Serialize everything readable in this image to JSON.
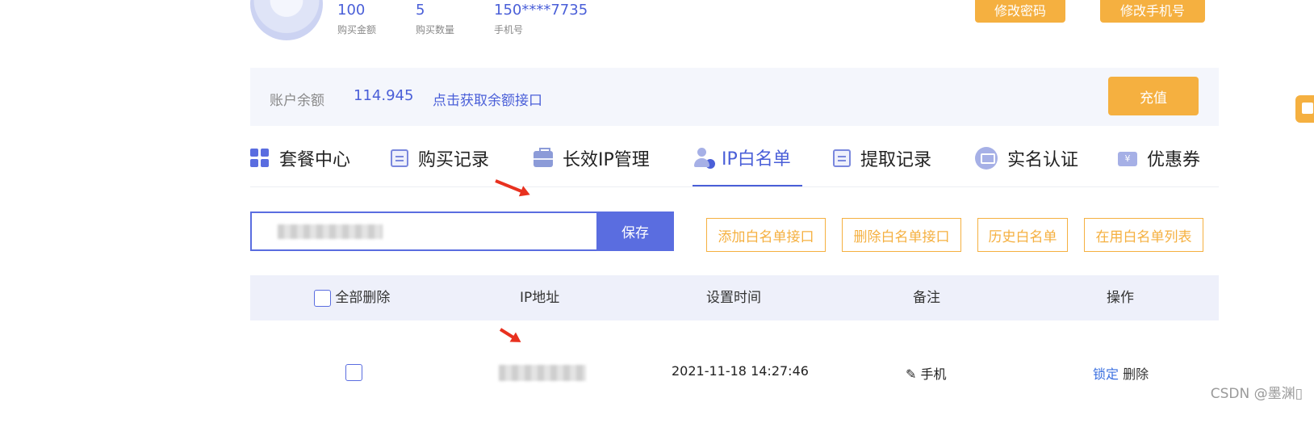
{
  "profile": {
    "stats": [
      {
        "value": "100",
        "label": "购买金额"
      },
      {
        "value": "5",
        "label": "购买数量"
      },
      {
        "value": "150****7735",
        "label": "手机号"
      }
    ],
    "change_password_label": "修改密码",
    "change_phone_label": "修改手机号"
  },
  "balance": {
    "label": "账户余额",
    "amount": "114.945",
    "api_link": "点击获取余额接口",
    "recharge_label": "充值"
  },
  "tabs": [
    {
      "label": "套餐中心",
      "icon": "grid-icon"
    },
    {
      "label": "购买记录",
      "icon": "edit-doc-icon"
    },
    {
      "label": "长效IP管理",
      "icon": "briefcase-icon"
    },
    {
      "label": "IP白名单",
      "icon": "user-check-icon",
      "active": true
    },
    {
      "label": "提取记录",
      "icon": "edit-doc-icon"
    },
    {
      "label": "实名认证",
      "icon": "monitor-icon"
    },
    {
      "label": "优惠券",
      "icon": "coupon-icon"
    }
  ],
  "whitelist": {
    "save_label": "保存",
    "actions": [
      "添加白名单接口",
      "删除白名单接口",
      "历史白名单",
      "在用白名单列表"
    ]
  },
  "table": {
    "headers": {
      "delete_all": "全部删除",
      "ip": "IP地址",
      "time": "设置时间",
      "note": "备注",
      "ops": "操作"
    },
    "rows": [
      {
        "time": "2021-11-18 14:27:46",
        "note": "手机",
        "lock": "锁定",
        "delete": "删除"
      }
    ]
  },
  "watermark": "CSDN @墨渊▯",
  "colors": {
    "accent": "#5a6de0",
    "orange": "#f5b040",
    "arrow": "#e8311f"
  }
}
